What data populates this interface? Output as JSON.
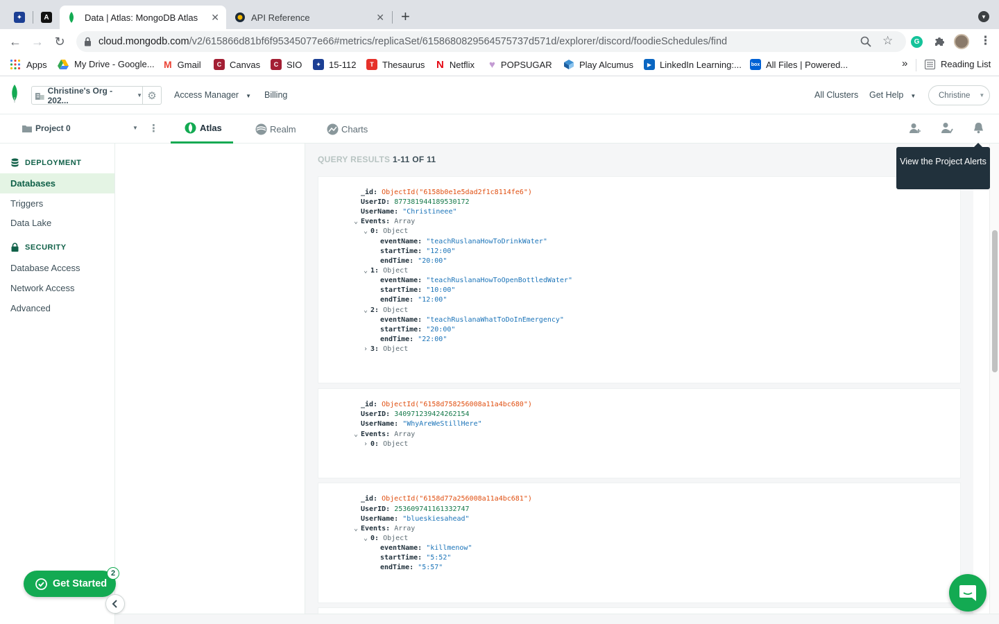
{
  "browser": {
    "tabs": [
      {
        "title": "Data | Atlas: MongoDB Atlas",
        "active": true
      },
      {
        "title": "API Reference",
        "active": false
      }
    ],
    "url_host": "cloud.mongodb.com",
    "url_path": "/v2/615866d81bf6f95345077e66#metrics/replicaSet/6158680829564575737d571d/explorer/discord/foodieSchedules/find",
    "bookmarks": [
      {
        "label": "Apps",
        "icon": "apps-grid-icon"
      },
      {
        "label": "My Drive - Google...",
        "icon": "google-drive-icon"
      },
      {
        "label": "Gmail",
        "icon": "gmail-icon"
      },
      {
        "label": "Canvas",
        "icon": "canvas-icon"
      },
      {
        "label": "SIO",
        "icon": "cmu-icon"
      },
      {
        "label": "15-112",
        "icon": "cmu-icon"
      },
      {
        "label": "Thesaurus",
        "icon": "thesaurus-icon"
      },
      {
        "label": "Netflix",
        "icon": "netflix-icon"
      },
      {
        "label": "POPSUGAR",
        "icon": "popsugar-icon"
      },
      {
        "label": "Play Alcumus",
        "icon": "alcumus-icon"
      },
      {
        "label": "LinkedIn Learning:...",
        "icon": "linkedin-learning-icon"
      },
      {
        "label": "All Files | Powered...",
        "icon": "box-icon"
      }
    ],
    "reading_list": "Reading List",
    "overflow": "»"
  },
  "header": {
    "org": "Christine's Org - 202...",
    "access_manager": "Access Manager",
    "billing": "Billing",
    "all_clusters": "All Clusters",
    "get_help": "Get Help",
    "user": "Christine"
  },
  "nav": {
    "project": "Project 0",
    "tabs": [
      "Atlas",
      "Realm",
      "Charts"
    ]
  },
  "sidebar": {
    "deployment_heading": "DEPLOYMENT",
    "deployment_items": [
      "Databases",
      "Triggers",
      "Data Lake"
    ],
    "security_heading": "SECURITY",
    "security_items": [
      "Database Access",
      "Network Access",
      "Advanced"
    ]
  },
  "results": {
    "label": "QUERY RESULTS",
    "range": "1-11 OF 11"
  },
  "documents": [
    {
      "id": "ObjectId(\"6158b0e1e5dad2f1c8114fe6\")",
      "userId": "877381944189530172",
      "userName": "\"Christineee\"",
      "events_type": "Array",
      "objects": [
        {
          "index": "0",
          "expanded": true,
          "eventName": "\"teachRuslanaHowToDrinkWater\"",
          "startTime": "\"12:00\"",
          "endTime": "\"20:00\""
        },
        {
          "index": "1",
          "expanded": true,
          "eventName": "\"teachRuslanaHowToOpenBottledWater\"",
          "startTime": "\"10:00\"",
          "endTime": "\"12:00\""
        },
        {
          "index": "2",
          "expanded": true,
          "eventName": "\"teachRuslanaWhatToDoInEmergency\"",
          "startTime": "\"20:00\"",
          "endTime": "\"22:00\""
        },
        {
          "index": "3",
          "expanded": false
        }
      ]
    },
    {
      "id": "ObjectId(\"6158d758256008a11a4bc680\")",
      "userId": "340971239424262154",
      "userName": "\"WhyAreWeStillHere\"",
      "events_type": "Array",
      "objects": [
        {
          "index": "0",
          "expanded": false
        }
      ]
    },
    {
      "id": "ObjectId(\"6158d77a256008a11a4bc681\")",
      "userId": "253609741161332747",
      "userName": "\"blueskiesahead\"",
      "events_type": "Array",
      "objects": [
        {
          "index": "0",
          "expanded": true,
          "eventName": "\"killmenow\"",
          "startTime": "\"5:52\"",
          "endTime": "\"5:57\""
        }
      ]
    }
  ],
  "labels": {
    "id_key": "_id:",
    "userid_key": "UserID:",
    "username_key": "UserName:",
    "events_key": "Events:",
    "eventname_key": "eventName:",
    "starttime_key": "startTime:",
    "endtime_key": "endTime:",
    "object_type": "Object"
  },
  "tooltip": "View the Project Alerts",
  "get_started": {
    "label": "Get Started",
    "badge": "2"
  },
  "colors": {
    "brand_green": "#13aa52",
    "dark_green": "#116149",
    "objectid": "#e04e0f",
    "string": "#1a73b8"
  }
}
